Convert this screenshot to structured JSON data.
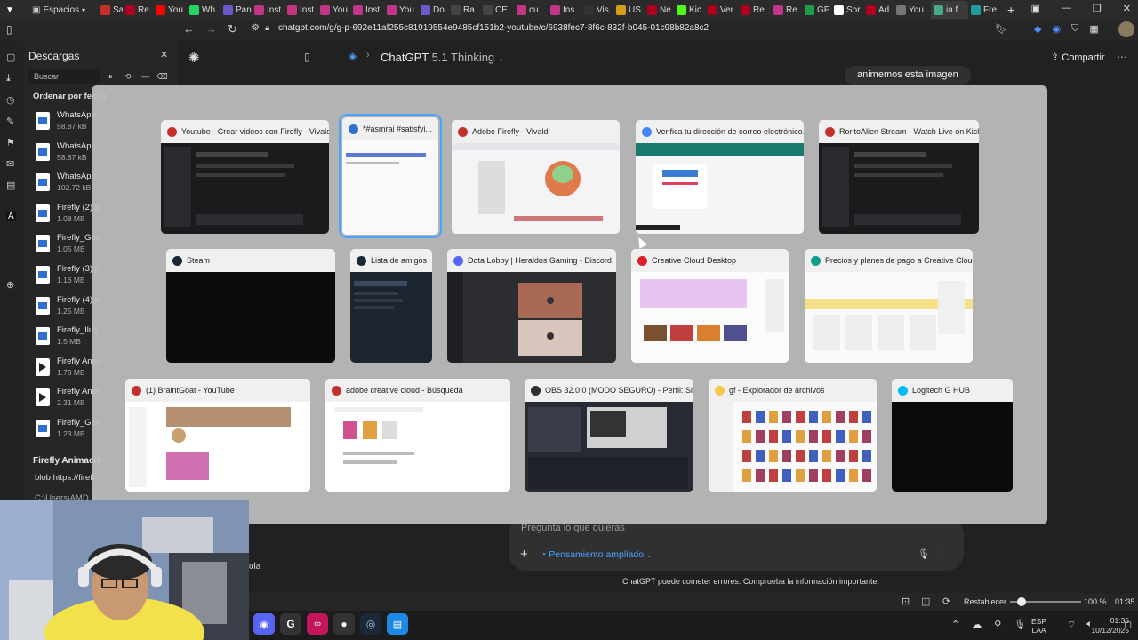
{
  "browser": {
    "workspace_label": "Espacios",
    "tabs": [
      {
        "label": "Sal",
        "color": "#c4302b"
      },
      {
        "label": "Re",
        "color": "#b00020"
      },
      {
        "label": "You",
        "color": "#ff0000"
      },
      {
        "label": "Wh",
        "color": "#25d366"
      },
      {
        "label": "Pan",
        "color": "#6a5acd"
      },
      {
        "label": "Inst",
        "color": "#c13584"
      },
      {
        "label": "Inst",
        "color": "#c13584"
      },
      {
        "label": "You",
        "color": "#c13584"
      },
      {
        "label": "Inst",
        "color": "#c13584"
      },
      {
        "label": "You",
        "color": "#c13584"
      },
      {
        "label": "Do",
        "color": "#6a5acd"
      },
      {
        "label": "Ra",
        "color": "#444"
      },
      {
        "label": "CE",
        "color": "#444"
      },
      {
        "label": "cu",
        "color": "#c13584"
      },
      {
        "label": "Ins",
        "color": "#c13584"
      },
      {
        "label": "Vis",
        "color": "#333"
      },
      {
        "label": "US",
        "color": "#d4a017"
      },
      {
        "label": "Ne",
        "color": "#b00020"
      },
      {
        "label": "Kic",
        "color": "#53fc18"
      },
      {
        "label": "Ver",
        "color": "#b00020"
      },
      {
        "label": "Re",
        "color": "#b00020"
      },
      {
        "label": "Re",
        "color": "#c13584"
      },
      {
        "label": "GF",
        "color": "#1e9e4a"
      },
      {
        "label": "Sor",
        "color": "#fff"
      },
      {
        "label": "Ad",
        "color": "#b00020"
      },
      {
        "label": "You",
        "color": "#777"
      },
      {
        "label": "ia f",
        "color": "#4a8"
      },
      {
        "label": "Fre",
        "color": "#1e9e9e"
      }
    ],
    "url": "chatgpt.com/g/g-p-692e11af255c81919554e9485cf151b2-youtube/c/6938fec7-8f6c-832f-b045-01c98b82a8c2"
  },
  "downloads": {
    "title": "Descargas",
    "search_placeholder": "Buscar",
    "sort_label": "Ordenar por fecha",
    "items": [
      {
        "name": "WhatsApp",
        "size": "58.87 kB",
        "kind": "img"
      },
      {
        "name": "WhatsApp",
        "size": "58.87 kB",
        "kind": "img"
      },
      {
        "name": "WhatsApp",
        "size": "102.72 kB",
        "kind": "img"
      },
      {
        "name": "Firefly (2).p",
        "size": "1.08 MB",
        "kind": "img"
      },
      {
        "name": "Firefly_Gen",
        "size": "1.05 MB",
        "kind": "img"
      },
      {
        "name": "Firefly (3).p",
        "size": "1.16 MB",
        "kind": "img"
      },
      {
        "name": "Firefly (4).p",
        "size": "1.25 MB",
        "kind": "img"
      },
      {
        "name": "Firefly_Ilus",
        "size": "1.5 MB",
        "kind": "img"
      },
      {
        "name": "Firefly Anim",
        "size": "1.78 MB",
        "kind": "vid"
      },
      {
        "name": "Firefly Anim",
        "size": "2.31 MB",
        "kind": "vid"
      },
      {
        "name": "Firefly_Gen",
        "size": "1.23 MB",
        "kind": "img"
      }
    ],
    "footer_title": "Firefly Animació",
    "footer_url": "blob:https://firefl",
    "footer_path": "C:\\Users\\AMD R"
  },
  "chat": {
    "model_label": "ChatGPT",
    "model_version": "5.1 Thinking",
    "share_label": "Compartir",
    "message_snippet": "animemos esta imagen",
    "input_placeholder": "Pregunta lo que quieras",
    "mode_label": "Pensamiento ampliado",
    "disclaimer": "ChatGPT puede cometer errores. Comprueba la información importante.",
    "side_text": "ola"
  },
  "switcher": {
    "windows": [
      {
        "title": "Youtube - Crear videos con Firefly - Vivaldi",
        "icon": "vivaldi-icon",
        "color": "#c4302b",
        "thumb": "dark"
      },
      {
        "title": "*#asmrai #satisfyi...",
        "icon": "notepad-icon",
        "color": "#2f6fd0",
        "thumb": "light"
      },
      {
        "title": "Adobe Firefly - Vivaldi",
        "icon": "vivaldi-icon",
        "color": "#c4302b",
        "thumb": "firefly"
      },
      {
        "title": "Verifica tu dirección de correo electrónico...",
        "icon": "chrome-icon",
        "color": "#4285f4",
        "thumb": "email"
      },
      {
        "title": "RoritoAlien Stream - Watch Live on Kick...",
        "icon": "vivaldi-icon",
        "color": "#c4302b",
        "thumb": "dark"
      },
      {
        "title": "Steam",
        "icon": "steam-icon",
        "color": "#1b2838",
        "thumb": "black"
      },
      {
        "title": "Lista de amigos",
        "icon": "steam-icon",
        "color": "#1b2838",
        "thumb": "friends"
      },
      {
        "title": "Dota Lobby | Heraldos Gaming - Discord",
        "icon": "discord-icon",
        "color": "#5865f2",
        "thumb": "discord"
      },
      {
        "title": "Creative Cloud Desktop",
        "icon": "creative-cloud-icon",
        "color": "#da1f26",
        "thumb": "cc"
      },
      {
        "title": "Precios y planes de pago a Creative Cloud...",
        "icon": "edge-icon",
        "color": "#0f9d8f",
        "thumb": "pricing"
      },
      {
        "title": "(1) BraintGoat - YouTube",
        "icon": "vivaldi-icon",
        "color": "#c4302b",
        "thumb": "youtube"
      },
      {
        "title": "adobe creative cloud - Búsqueda",
        "icon": "vivaldi-icon",
        "color": "#c4302b",
        "thumb": "search"
      },
      {
        "title": "OBS 32.0.0 (MODO SEGURO) - Perfil: Sin Tí...",
        "icon": "obs-icon",
        "color": "#302e31",
        "thumb": "obs"
      },
      {
        "title": "gf - Explorador de archivos",
        "icon": "folder-icon",
        "color": "#f3c84b",
        "thumb": "explorer"
      },
      {
        "title": "Logitech G HUB",
        "icon": "logitech-icon",
        "color": "#00b8fc",
        "thumb": "black"
      }
    ]
  },
  "statusbar": {
    "reset_label": "Restablecer",
    "zoom": "100 %",
    "time": "01:35"
  },
  "taskbar": {
    "lang": "ESP",
    "lang_sub": "LAA",
    "clock_time": "01:35",
    "clock_date": "10/12/2025"
  }
}
